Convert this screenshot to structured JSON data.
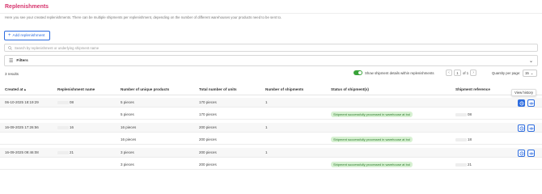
{
  "page": {
    "title": "Replenishments",
    "subtitle": "Here you see your created replenishments. There can be multiple shipments per replenishment, depending on the number of different warehouses your products need to be sent to."
  },
  "toolbar": {
    "add_label": "Add replenishment",
    "search_placeholder": "Search by replenishment or underlying shipment name",
    "filters_label": "Filters",
    "results_text": "3 results",
    "toggle_label": "Show shipment details within replenishments",
    "toggle_on": true,
    "pager": {
      "current": "1",
      "of_text": "of 1"
    },
    "qty_label": "Quantity per page:",
    "qty_value": "15"
  },
  "colors": {
    "accent": "#2d6cdf",
    "title": "#d6336c",
    "success_bg": "#d7f1d2",
    "success_text": "#2b7a2b"
  },
  "table": {
    "headers": {
      "created_at": "Created at",
      "name": "Replenishment name",
      "unique": "Number of unique products",
      "units": "Total number of units",
      "shipments": "Number of shipments",
      "status": "Status of shipment(s)",
      "reference": "Shipment reference"
    },
    "rows": [
      {
        "created": "06-10-2025 18:19:29",
        "name": "08",
        "unique": "5 pieces",
        "units": "170 pieces",
        "shipments": "1",
        "status": "",
        "reference": ""
      },
      {
        "created": "",
        "name": "",
        "unique": "5 pieces",
        "units": "170 pieces",
        "shipments": "",
        "status": "Shipment successfully processed in warehouse at bol",
        "reference": "08"
      },
      {
        "created": "16-09-2025 17:26:56",
        "name": "16",
        "unique": "16 pieces",
        "units": "200 pieces",
        "shipments": "1",
        "status": "",
        "reference": ""
      },
      {
        "created": "",
        "name": "",
        "unique": "16 pieces",
        "units": "200 pieces",
        "shipments": "",
        "status": "Shipment successfully processed in warehouse at bol",
        "reference": "18"
      },
      {
        "created": "16-09-2025 09:46:08",
        "name": "21",
        "unique": "3 pieces",
        "units": "200 pieces",
        "shipments": "1",
        "status": "",
        "reference": ""
      },
      {
        "created": "",
        "name": "",
        "unique": "3 pieces",
        "units": "200 pieces",
        "shipments": "",
        "status": "Shipment successfully processed in warehouse at bol",
        "reference": "21"
      }
    ],
    "tooltip": "View history"
  }
}
